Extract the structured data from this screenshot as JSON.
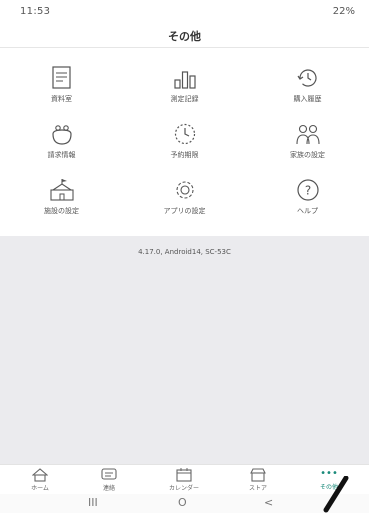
{
  "status_bar": {
    "time": "11:53",
    "right": "22%"
  },
  "header": {
    "title": "その他"
  },
  "menu": [
    {
      "label": "資料室",
      "icon": "document-icon"
    },
    {
      "label": "測定記録",
      "icon": "bar-chart-icon"
    },
    {
      "label": "購入履歴",
      "icon": "history-icon"
    },
    {
      "label": "請求情報",
      "icon": "wallet-icon"
    },
    {
      "label": "予約期限",
      "icon": "clock-icon"
    },
    {
      "label": "家族の設定",
      "icon": "family-icon"
    },
    {
      "label": "施設の設定",
      "icon": "school-icon"
    },
    {
      "label": "アプリの設定",
      "icon": "gear-icon"
    },
    {
      "label": "ヘルプ",
      "icon": "help-icon"
    }
  ],
  "version": "4.17.0, Android14, SC-53C",
  "bottom_nav": [
    {
      "label": "ホーム",
      "icon": "home-icon"
    },
    {
      "label": "連絡",
      "icon": "message-icon"
    },
    {
      "label": "カレンダー",
      "icon": "calendar-icon"
    },
    {
      "label": "ストア",
      "icon": "store-icon"
    },
    {
      "label": "その他",
      "icon": "more-icon",
      "active": true
    }
  ],
  "system_nav": {
    "recents": "III",
    "home": "O",
    "back": "<"
  },
  "colors": {
    "accent": "#1a8a7a",
    "background_gray": "#ebebee"
  }
}
